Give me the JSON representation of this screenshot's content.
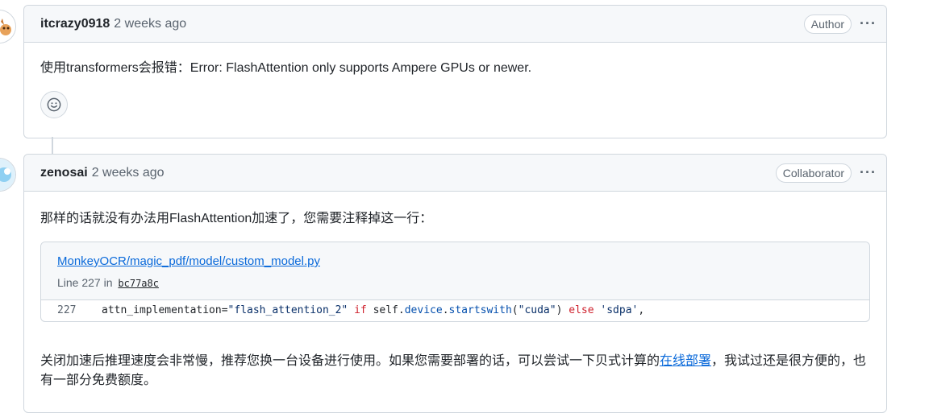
{
  "comments": [
    {
      "author": "itcrazy0918",
      "time": "2 weeks ago",
      "role": "Author",
      "body": "使用transformers会报错：Error: FlashAttention only supports Ampere GPUs or newer."
    },
    {
      "author": "zenosai",
      "time": "2 weeks ago",
      "role": "Collaborator",
      "intro": "那样的话就没有办法用FlashAttention加速了，您需要注释掉这一行：",
      "code_ref": {
        "path": "MonkeyOCR/magic_pdf/model/custom_model.py",
        "line_label": "Line 227 in",
        "sha": "bc77a8c",
        "line_number": "227",
        "code_parts": {
          "a": "attn_implementation=",
          "b": "\"flash_attention_2\"",
          "c": " if ",
          "d": "self.",
          "e": "device",
          "f": ".",
          "g": "startswith",
          "h": "(",
          "i": "\"cuda\"",
          "j": ") ",
          "k": "else",
          "l": " ",
          "m": "'sdpa'",
          "n": ","
        }
      },
      "para_before_link": "关闭加速后推理速度会非常慢，推荐您换一台设备进行使用。如果您需要部署的话，可以尝试一下贝式计算的",
      "link_text": "在线部署",
      "para_after_link": "，我试过还是很方便的，也有一部分免费额度。"
    }
  ],
  "icons": {
    "menu": "kebab-horizontal-icon",
    "reaction": "smiley-icon"
  },
  "colors": {
    "link": "#0969da",
    "keyword": "#cf222e",
    "string": "#0a3069",
    "entity": "#0550ae"
  }
}
